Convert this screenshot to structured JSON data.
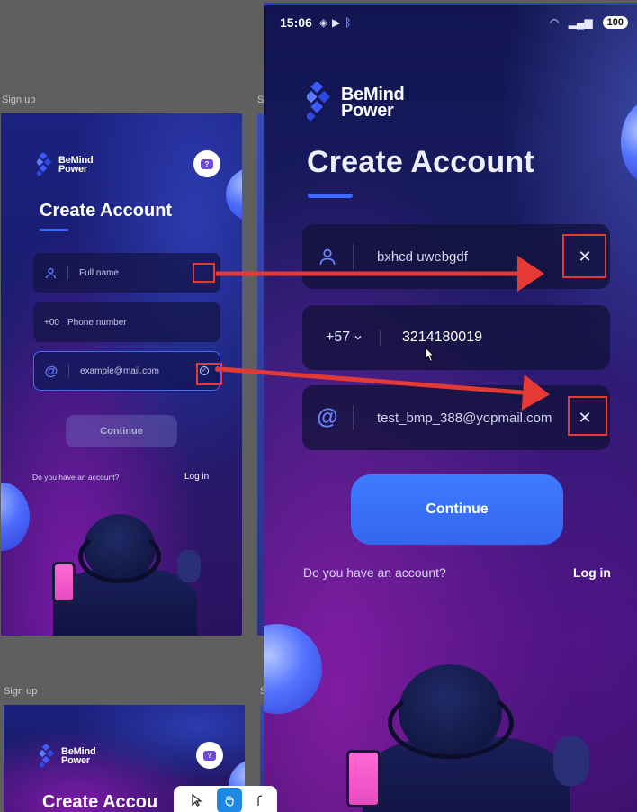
{
  "canvas": {
    "frame_labels": [
      "Sign up",
      "Si",
      "Sign up",
      "S"
    ]
  },
  "design_frame": {
    "brand": [
      "BeMind",
      "Power"
    ],
    "title": "Create Account",
    "help_icon": "?",
    "fields": {
      "full_name_placeholder": "Full name",
      "phone_prefix": "+00",
      "phone_placeholder": "Phone number",
      "email_placeholder": "example@mail.com"
    },
    "continue_label": "Continue",
    "have_account": "Do you have an account?",
    "login": "Log in"
  },
  "design_frame_2": {
    "brand": [
      "BeMind",
      "Power"
    ],
    "title_partial": "Create Accou"
  },
  "status_bar": {
    "time": "15:06",
    "battery": "100"
  },
  "phone_screen": {
    "brand": [
      "BeMind",
      "Power"
    ],
    "title": "Create Account",
    "full_name_value": "bxhcd uwebgdf",
    "country_code": "+57",
    "phone_value": "3214180019",
    "email_value": "test_bmp_388@yopmail.com",
    "clear_glyph": "✕",
    "continue_label": "Continue",
    "have_account": "Do you have an account?",
    "login": "Log in"
  },
  "annotations": {
    "color": "#e53935"
  },
  "icons": [
    "user-icon",
    "at-icon",
    "clear-icon",
    "chevron-down-icon",
    "check-circle-icon",
    "chat-help-icon",
    "logo-icon",
    "pointer-tool-icon",
    "hand-tool-icon"
  ]
}
